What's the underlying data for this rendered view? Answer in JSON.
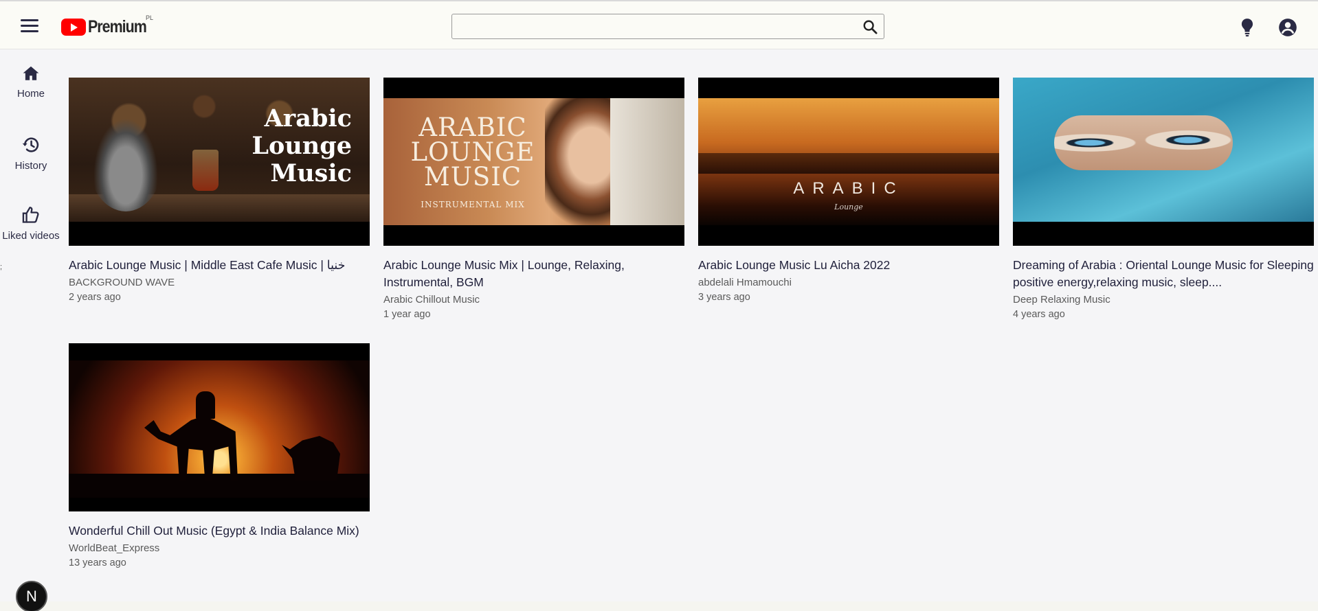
{
  "header": {
    "logo_text": "Premium",
    "region_code": "PL",
    "search_placeholder": "",
    "search_value": ""
  },
  "sidebar": {
    "items": [
      {
        "label": "Home",
        "icon": "home-icon"
      },
      {
        "label": "History",
        "icon": "history-icon"
      },
      {
        "label": "Liked videos",
        "icon": "thumbs-up-icon"
      }
    ],
    "stray_mark": ";"
  },
  "videos": [
    {
      "title": "Arabic Lounge Music | Middle East Cafe Music | خنيا",
      "channel": "BACKGROUND WAVE",
      "age": "2 years ago",
      "thumb_text": [
        "Arabic",
        "Lounge",
        "Music"
      ]
    },
    {
      "title": "Arabic Lounge Music Mix | Lounge, Relaxing, Instrumental, BGM",
      "channel": "Arabic Chillout Music",
      "age": "1 year ago",
      "thumb_text": [
        "ARABIC",
        "LOUNGE",
        "MUSIC"
      ],
      "thumb_sub": "INSTRUMENTAL MIX"
    },
    {
      "title": "Arabic Lounge Music Lu Aicha 2022",
      "channel": "abdelali Hmamouchi",
      "age": "3 years ago",
      "thumb_text": [
        "ARABIC"
      ],
      "thumb_sub": "Lounge"
    },
    {
      "title": "Dreaming of Arabia : Oriental Lounge Music for Sleeping positive energy,relaxing music, sleep....",
      "channel": "Deep Relaxing Music",
      "age": "4 years ago"
    },
    {
      "title": "Wonderful Chill Out Music (Egypt & India Balance Mix)",
      "channel": "WorldBeat_Express",
      "age": "13 years ago"
    }
  ],
  "badge": {
    "letter": "N"
  },
  "colors": {
    "brand_red": "#ff0000",
    "text_dark": "#1f1f3a",
    "background": "#f5f5f7"
  }
}
